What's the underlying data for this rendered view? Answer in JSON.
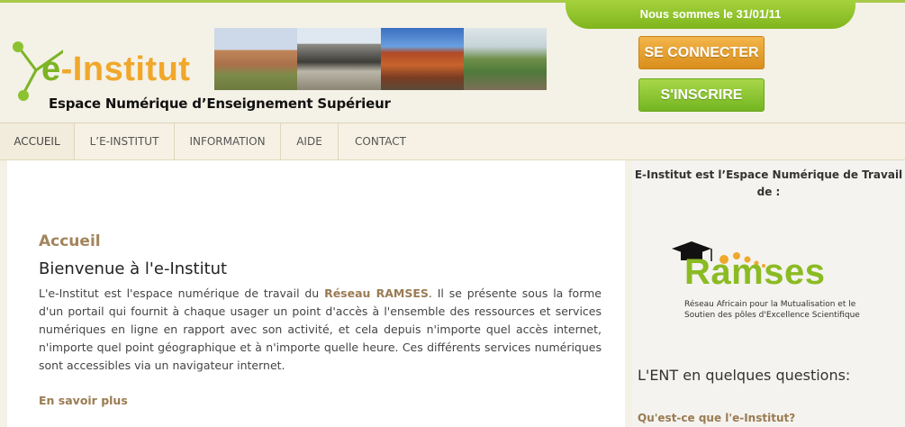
{
  "header": {
    "date_banner": "Nous sommes le 31/01/11",
    "logo": {
      "prefix": "e",
      "name": "-Institut"
    },
    "tagline": "Espace Numérique d’Enseignement Supérieur",
    "login_button": "SE CONNECTER",
    "signup_button": "S'INSCRIRE"
  },
  "nav": {
    "items": [
      {
        "label": "ACCUEIL",
        "active": true
      },
      {
        "label": "L’E-INSTITUT",
        "active": false
      },
      {
        "label": "INFORMATION",
        "active": false
      },
      {
        "label": "AIDE",
        "active": false
      },
      {
        "label": "CONTACT",
        "active": false
      }
    ]
  },
  "main": {
    "section_title": "Accueil",
    "welcome_title": "Bienvenue à l'e-Institut",
    "intro_before": "L'e-Institut est l'espace numérique de travail du ",
    "intro_highlight": "Réseau RAMSES",
    "intro_after": ". Il se présente sous la forme d'un portail qui fournit à chaque usager un point d'accès à l'ensemble des ressources et services numériques en ligne en rapport avec son activité, et cela depuis n'importe quel accès internet, n'importe quel point géographique et à n'importe quelle heure. Ces différents services numériques sont accessibles via un navigateur internet.",
    "more_link": "En savoir plus"
  },
  "sidebar": {
    "title_line1": "E-Institut est l’Espace Numérique de Travail",
    "title_line2": "de :",
    "partner_logo": {
      "name": "Ramses",
      "subtitle_line1": "Réseau Africain pour la Mutualisation et le",
      "subtitle_line2": "Soutien des pôles d'Excellence Scientifique"
    },
    "faq_heading": "L'ENT en quelques questions:",
    "faq_first_link": "Qu'est-ce que l'e-Institut?"
  },
  "colors": {
    "accent_green": "#7cb424",
    "accent_orange": "#f0a72a",
    "link_brown": "#9a7b53"
  }
}
